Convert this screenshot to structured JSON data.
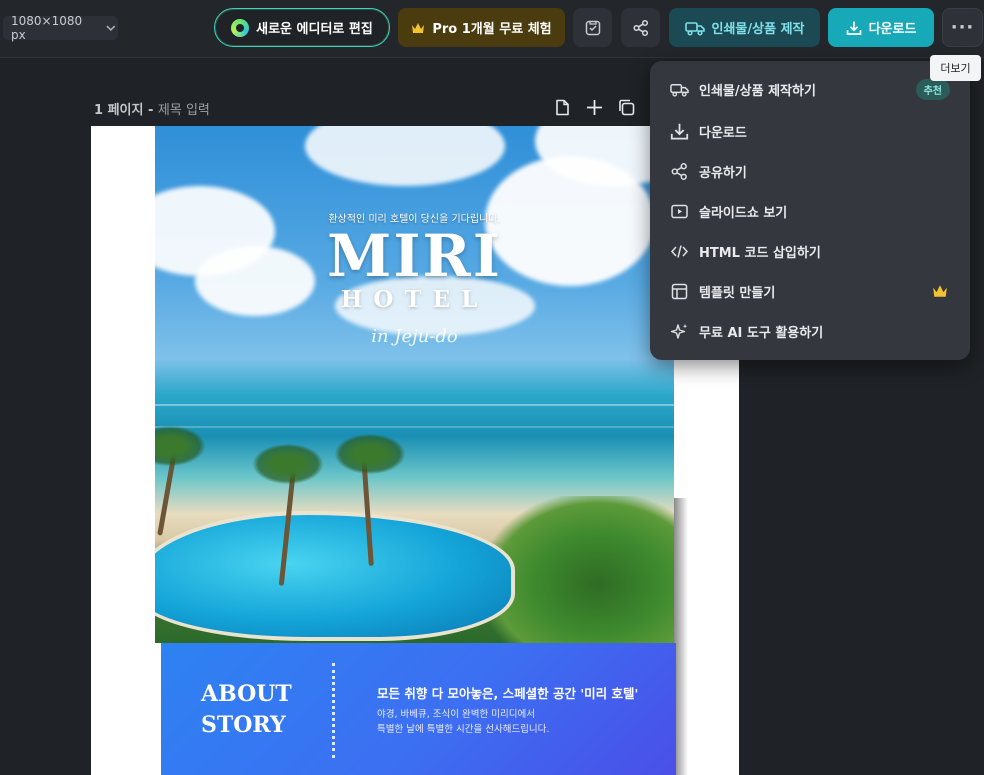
{
  "toolbar": {
    "size_select": "1080×1080 px",
    "new_editor_label": "새로운 에디터로 편집",
    "pro_trial_label": "Pro 1개월 무료 체험",
    "print_label": "인쇄물/상품 제작",
    "download_label": "다운로드",
    "more_label": "···",
    "more_tooltip": "더보기"
  },
  "page": {
    "number_label": "1 페이지 -",
    "title_placeholder": "제목 입력"
  },
  "design": {
    "tagline": "환상적인 미리 호텔이 당신을 기다립니다.",
    "title": "MIRI",
    "subtitle": "HOTEL",
    "script": "in Jeju-do",
    "about_title_line1": "ABOUT",
    "about_title_line2": "STORY",
    "about_heading": "모든 취향 다 모아놓은, 스페셜한 공간 '미리 호텔'",
    "about_body_line1": "야경, 바베큐, 조식이 완벽한 미리디에서",
    "about_body_line2": "특별한 날에 특별한 시간을 선사해드립니다."
  },
  "menu": {
    "items": [
      {
        "label": "인쇄물/상품 제작하기",
        "icon": "truck-icon",
        "badge": "추천"
      },
      {
        "label": "다운로드",
        "icon": "download-icon"
      },
      {
        "label": "공유하기",
        "icon": "share-icon"
      },
      {
        "label": "슬라이드쇼 보기",
        "icon": "play-icon"
      },
      {
        "label": "HTML 코드 삽입하기",
        "icon": "code-icon"
      },
      {
        "label": "템플릿 만들기",
        "icon": "template-icon",
        "pro": true
      },
      {
        "label": "무료 AI 도구 활용하기",
        "icon": "sparkle-icon"
      }
    ]
  },
  "colors": {
    "accent_teal": "#17a9b8",
    "pro_gold": "#f2c230",
    "about_blue": "#3c6ff2"
  }
}
